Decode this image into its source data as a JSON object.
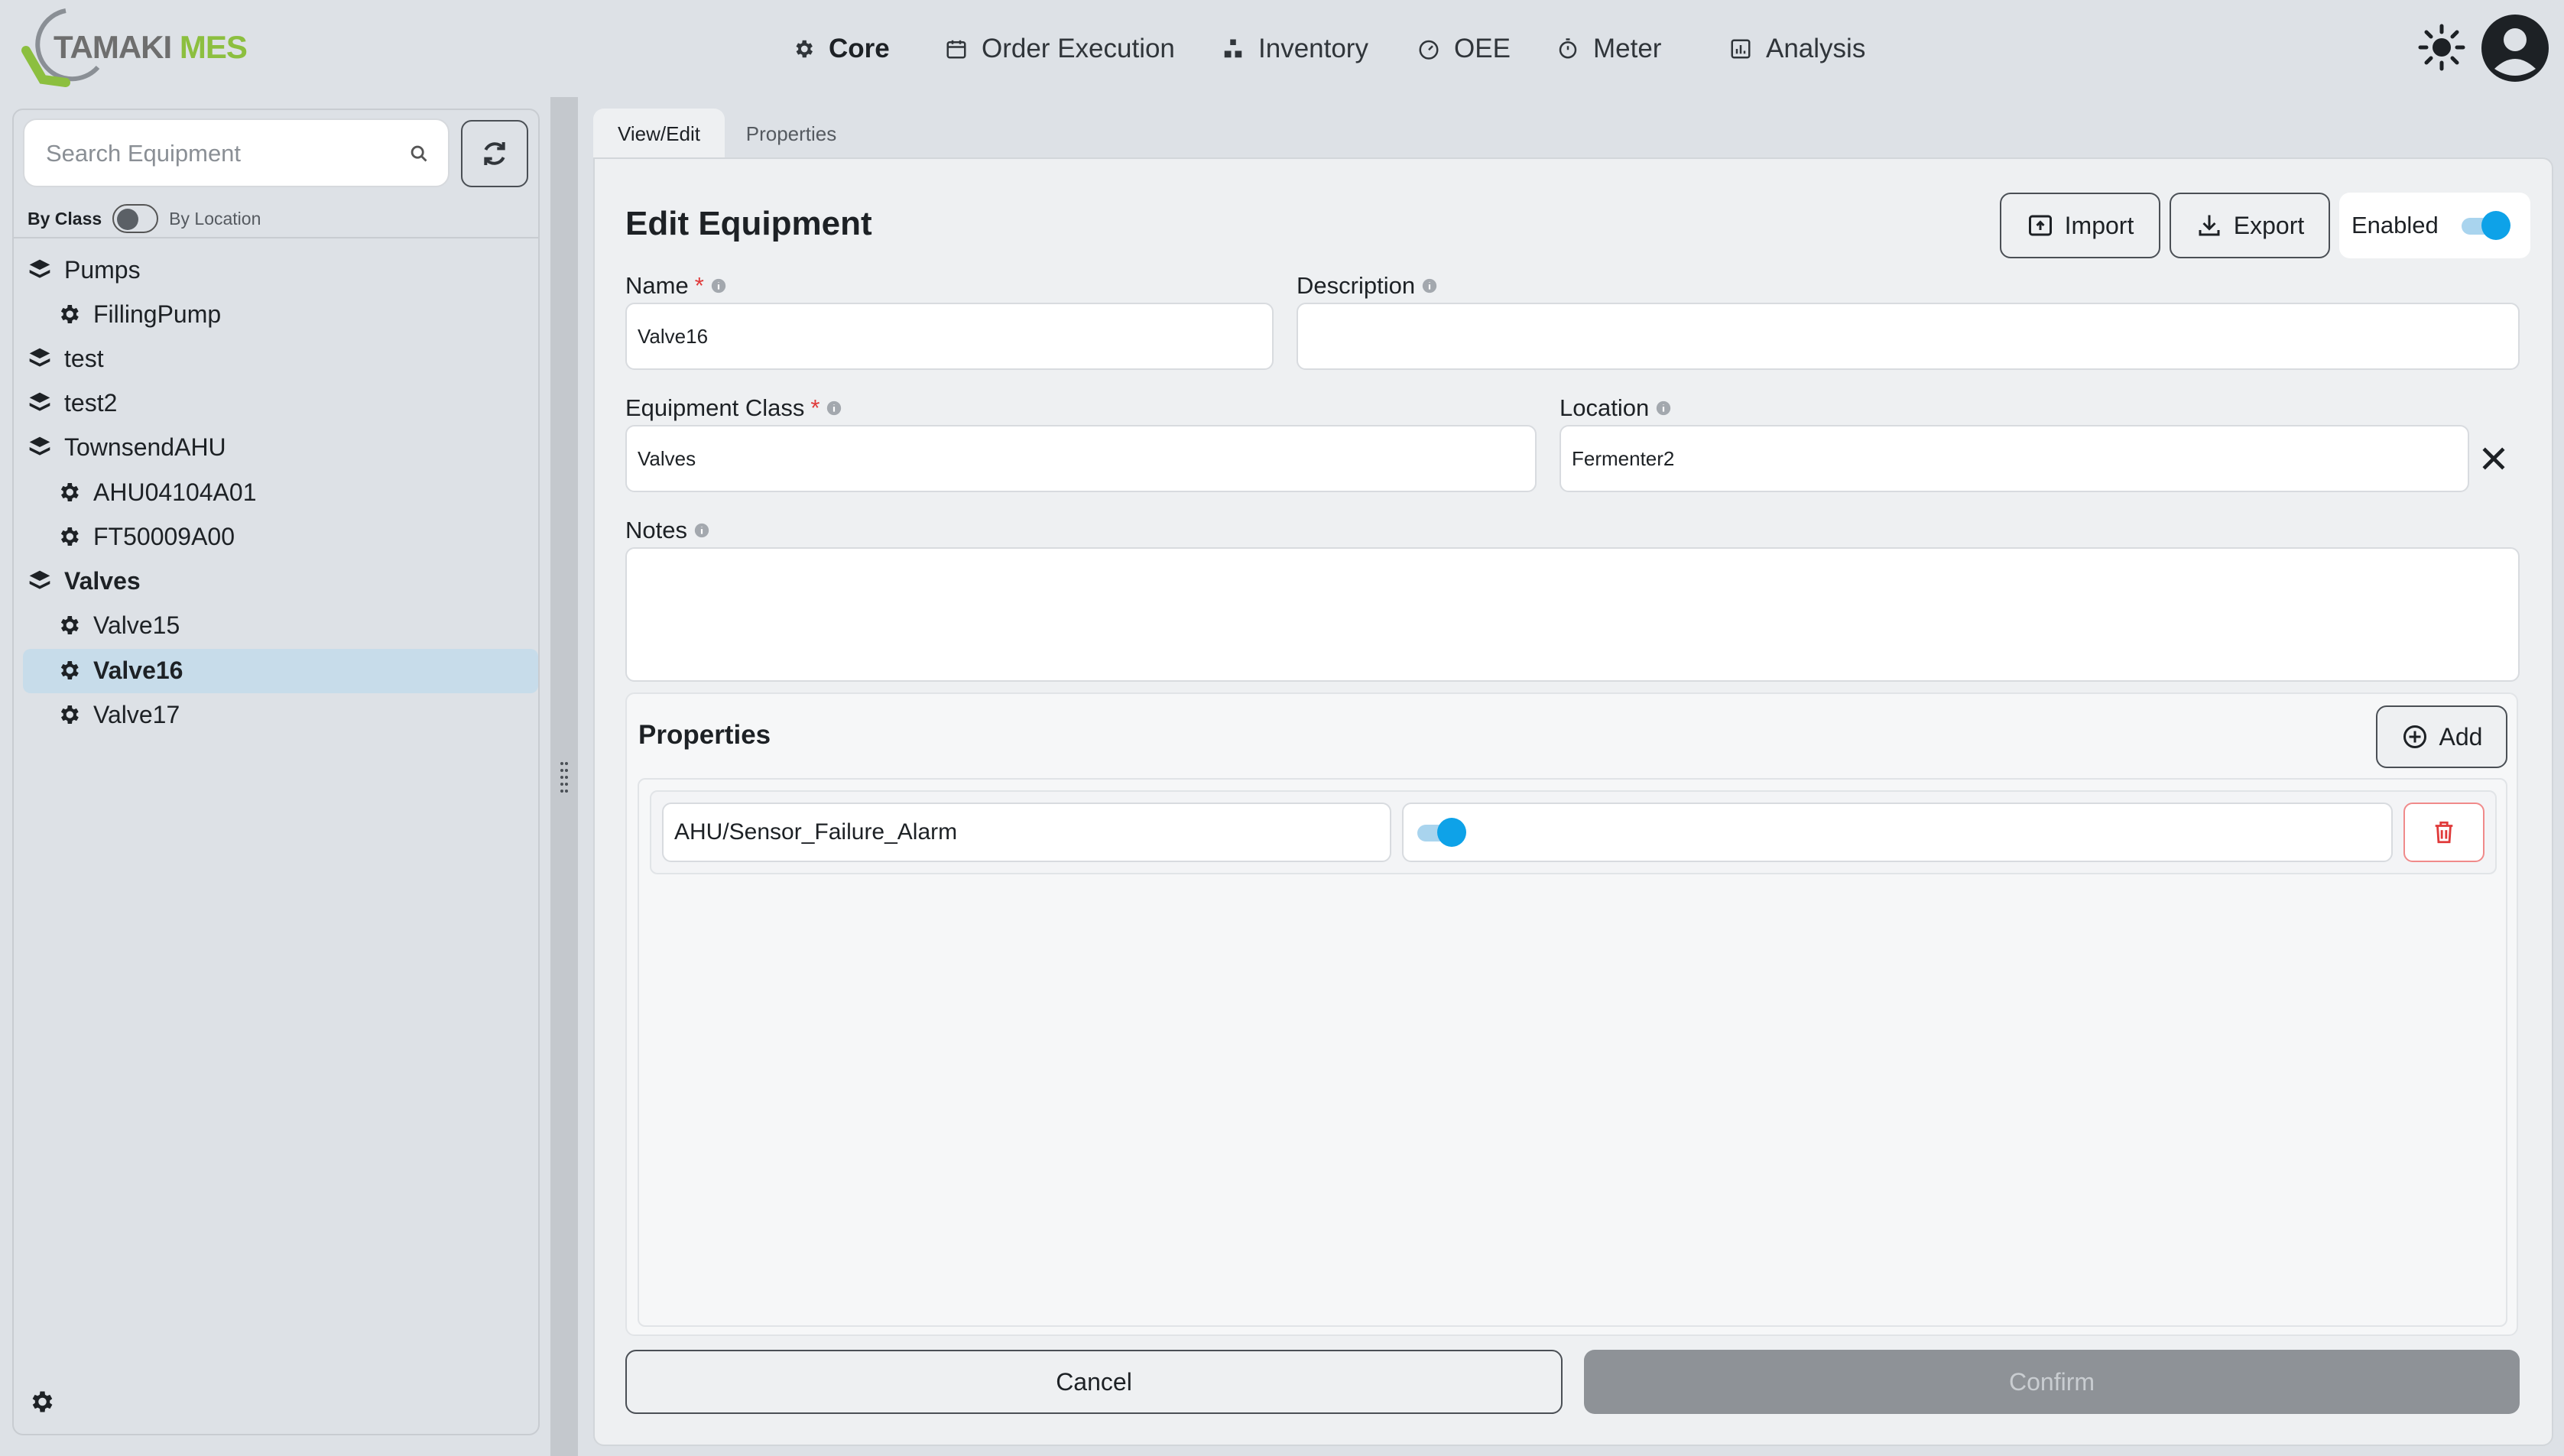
{
  "logo": {
    "part1": "TAMAKI",
    "part2": "MES"
  },
  "nav": [
    {
      "label": "Core",
      "icon": "gear-icon",
      "active": true
    },
    {
      "label": "Order Execution",
      "icon": "calendar-icon"
    },
    {
      "label": "Inventory",
      "icon": "boxes-icon"
    },
    {
      "label": "OEE",
      "icon": "gauge-icon"
    },
    {
      "label": "Meter",
      "icon": "stopwatch-icon"
    },
    {
      "label": "Analysis",
      "icon": "chart-icon"
    }
  ],
  "sidebar": {
    "search_placeholder": "Search Equipment",
    "switch_left": "By Class",
    "switch_right": "By Location",
    "tree": [
      {
        "label": "Pumps",
        "type": "class"
      },
      {
        "label": "FillingPump",
        "type": "equipment"
      },
      {
        "label": "test",
        "type": "class"
      },
      {
        "label": "test2",
        "type": "class"
      },
      {
        "label": "TownsendAHU",
        "type": "class"
      },
      {
        "label": "AHU04104A01",
        "type": "equipment"
      },
      {
        "label": "FT50009A00",
        "type": "equipment"
      },
      {
        "label": "Valves",
        "type": "class"
      },
      {
        "label": "Valve15",
        "type": "equipment"
      },
      {
        "label": "Valve16",
        "type": "equipment"
      },
      {
        "label": "Valve17",
        "type": "equipment"
      }
    ]
  },
  "tabs": {
    "view_edit": "View/Edit",
    "properties": "Properties"
  },
  "form": {
    "title": "Edit Equipment",
    "import_label": "Import",
    "export_label": "Export",
    "enabled_label": "Enabled",
    "name_label": "Name",
    "name_value": "Valve16",
    "description_label": "Description",
    "description_value": "",
    "class_label": "Equipment Class",
    "class_value": "Valves",
    "location_label": "Location",
    "location_value": "Fermenter2",
    "notes_label": "Notes",
    "notes_value": "",
    "required_mark": "*"
  },
  "properties": {
    "title": "Properties",
    "add_label": "Add",
    "rows": [
      {
        "name": "AHU/Sensor_Failure_Alarm",
        "value_enabled": true
      }
    ]
  },
  "actions": {
    "cancel": "Cancel",
    "confirm": "Confirm"
  },
  "colors": {
    "accent": "#0ea2e8",
    "brand_green": "#8cbf3f",
    "danger": "#e03a3a"
  }
}
